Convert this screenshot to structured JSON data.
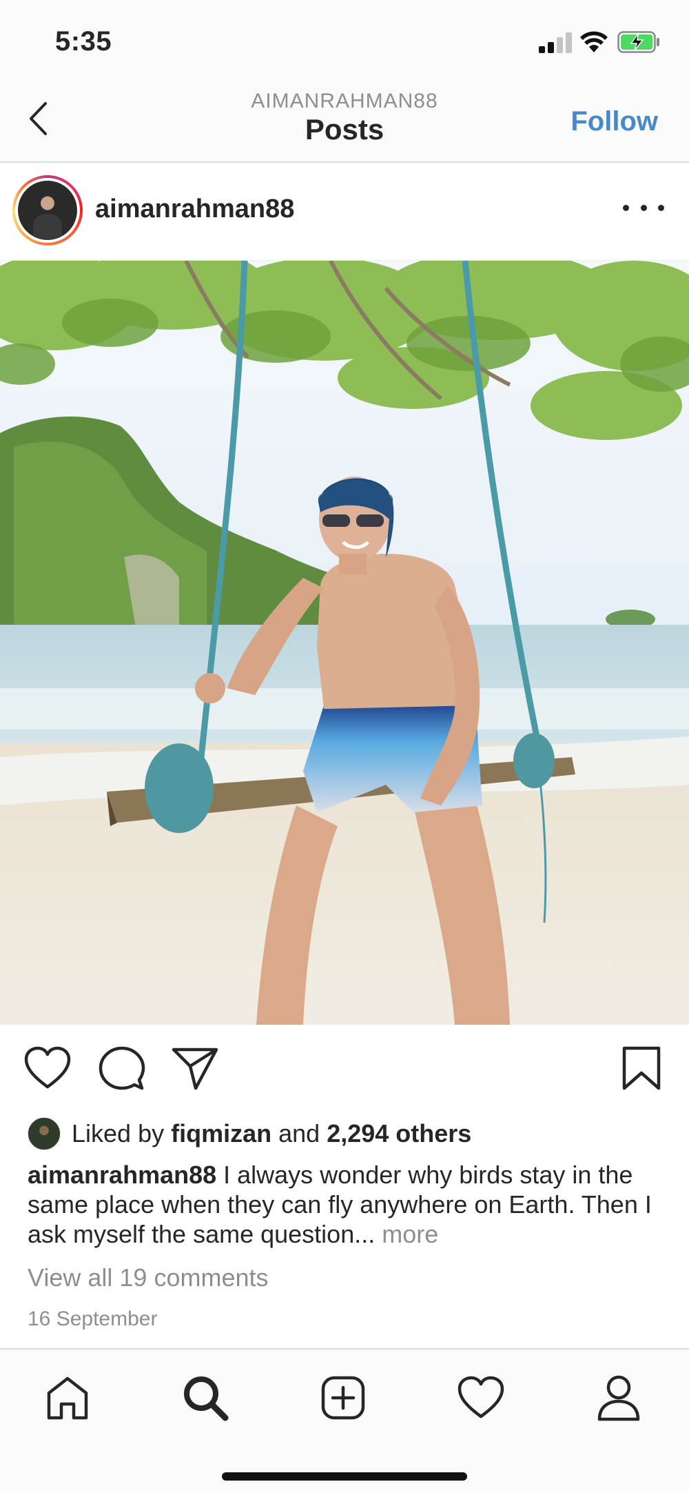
{
  "status_bar": {
    "time": "5:35",
    "icons": [
      "cellular-signal-icon",
      "wifi-icon",
      "battery-charging-icon"
    ],
    "battery_color": "#4cd964"
  },
  "nav": {
    "back_icon": "chevron-left-icon",
    "username": "AIMANRAHMAN88",
    "title": "Posts",
    "follow_label": "Follow"
  },
  "post": {
    "username": "aimanrahman88",
    "more_icon": "more-horizontal-icon",
    "image_subject": "beach-swing-photo",
    "actions": {
      "like_icon": "heart-icon",
      "comment_icon": "comment-icon",
      "share_icon": "paper-plane-icon",
      "save_icon": "bookmark-icon"
    },
    "likes": {
      "prefix": "Liked by ",
      "user": "fiqmizan",
      "middle": " and ",
      "others": "2,294 others"
    },
    "caption": {
      "username": "aimanrahman88",
      "text": " I always wonder why birds stay in the same place when they can fly anywhere on Earth. Then I ask myself the same question... ",
      "more_label": "more"
    },
    "comments_label": "View all 19 comments",
    "date": "16 September"
  },
  "tab_bar": {
    "items": [
      "home-icon",
      "search-icon",
      "new-post-icon",
      "activity-heart-icon",
      "profile-icon"
    ],
    "active": "search-icon"
  },
  "colors": {
    "link_blue": "#4a89c8",
    "text": "#262626",
    "secondary_text": "#8e8e8e",
    "divider": "#dbdbdb"
  }
}
